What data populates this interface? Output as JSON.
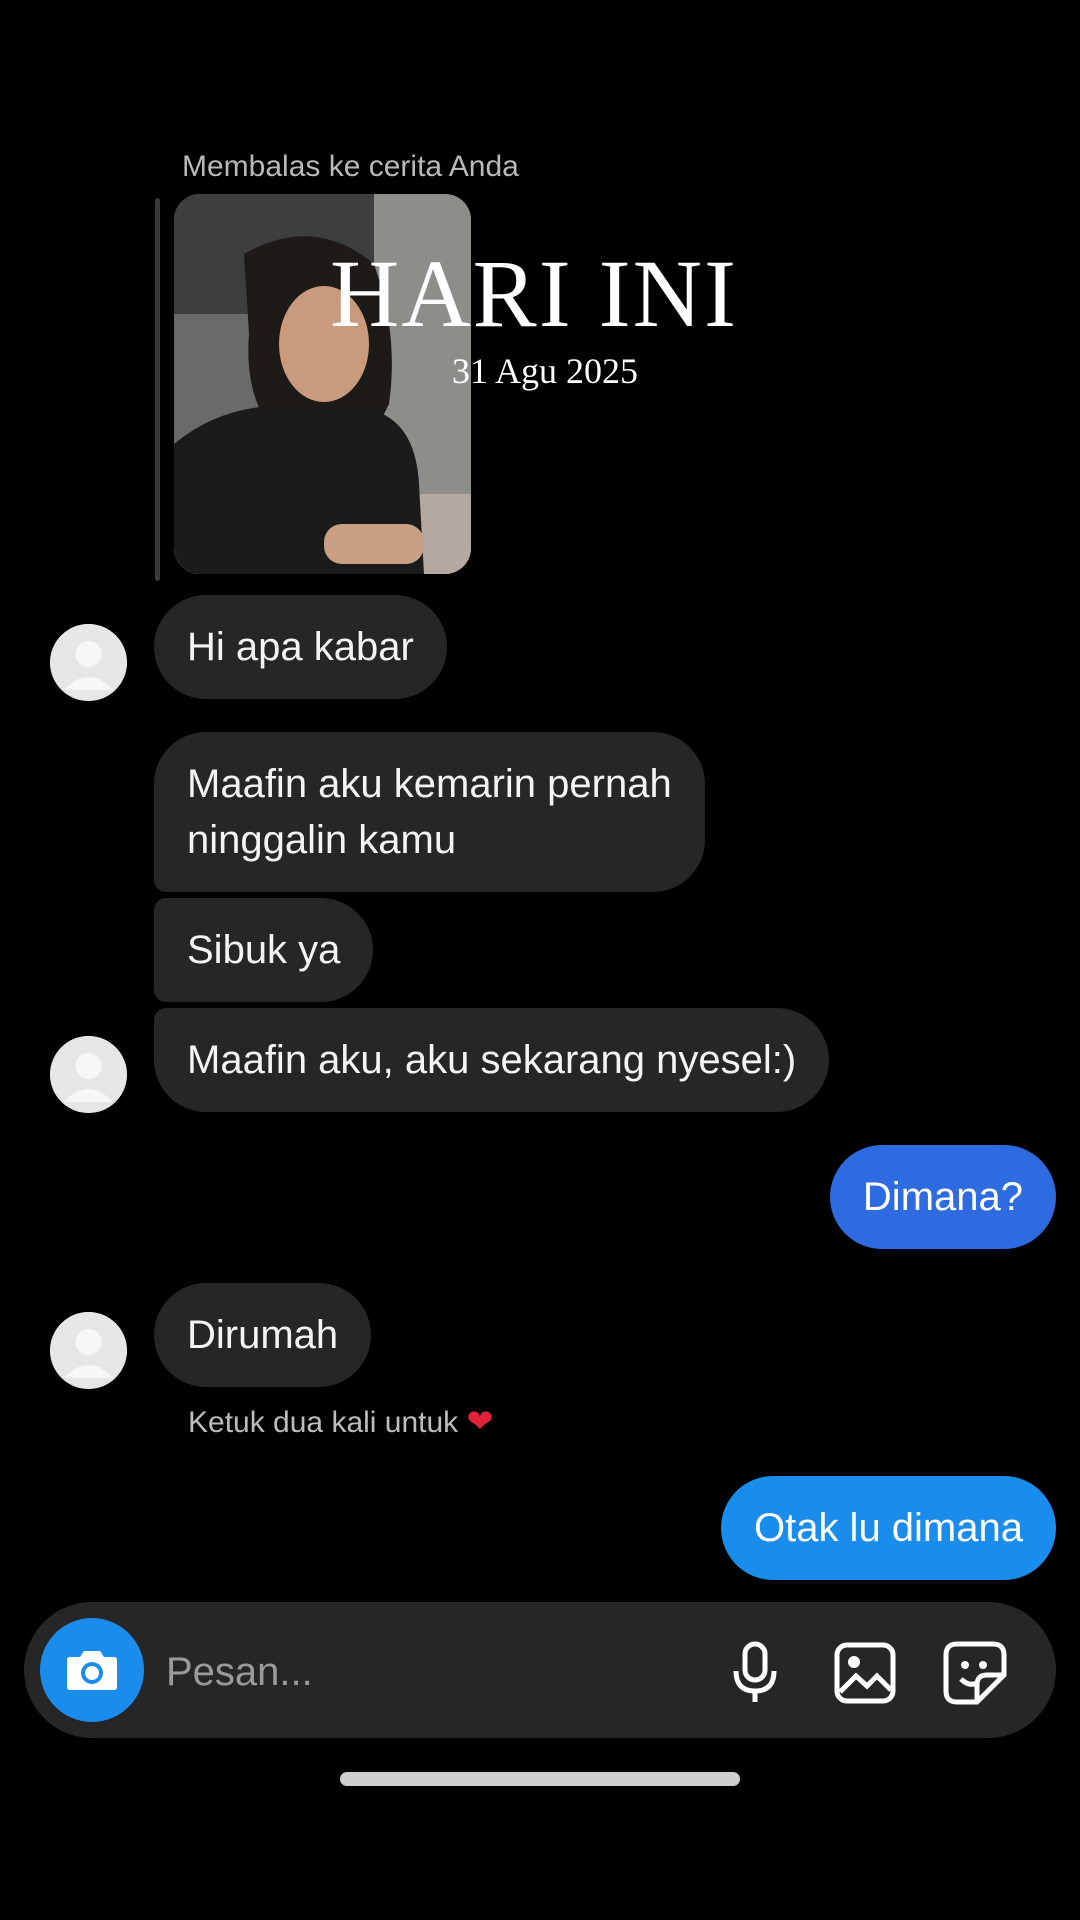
{
  "story_reply": {
    "label": "Membalas ke cerita Anda",
    "overlay_title": "HARI INI",
    "overlay_date": "31 Agu 2025"
  },
  "messages": [
    {
      "from": "them",
      "text": "Hi apa kabar"
    },
    {
      "from": "them",
      "lines": [
        "Maafin aku kemarin pernah",
        "ninggalin kamu"
      ]
    },
    {
      "from": "them",
      "text": "Sibuk ya"
    },
    {
      "from": "them",
      "text": "Maafin aku, aku sekarang nyesel:)"
    },
    {
      "from": "me",
      "text": "Dimana?"
    },
    {
      "from": "them",
      "text": "Dirumah"
    },
    {
      "from": "me",
      "text": "Otak lu dimana"
    }
  ],
  "hint": {
    "text": "Ketuk dua kali untuk",
    "icon": "heart-icon",
    "color": "#e0213a"
  },
  "composer": {
    "placeholder": "Pesan..."
  },
  "colors": {
    "background": "#000000",
    "incoming_bubble": "#262626",
    "outgoing_bubble_start": "#2f6be0",
    "outgoing_bubble_end": "#1a8ceb",
    "camera_button": "#1a8ceb"
  },
  "icons": [
    "camera-icon",
    "microphone-icon",
    "gallery-icon",
    "sticker-icon"
  ]
}
